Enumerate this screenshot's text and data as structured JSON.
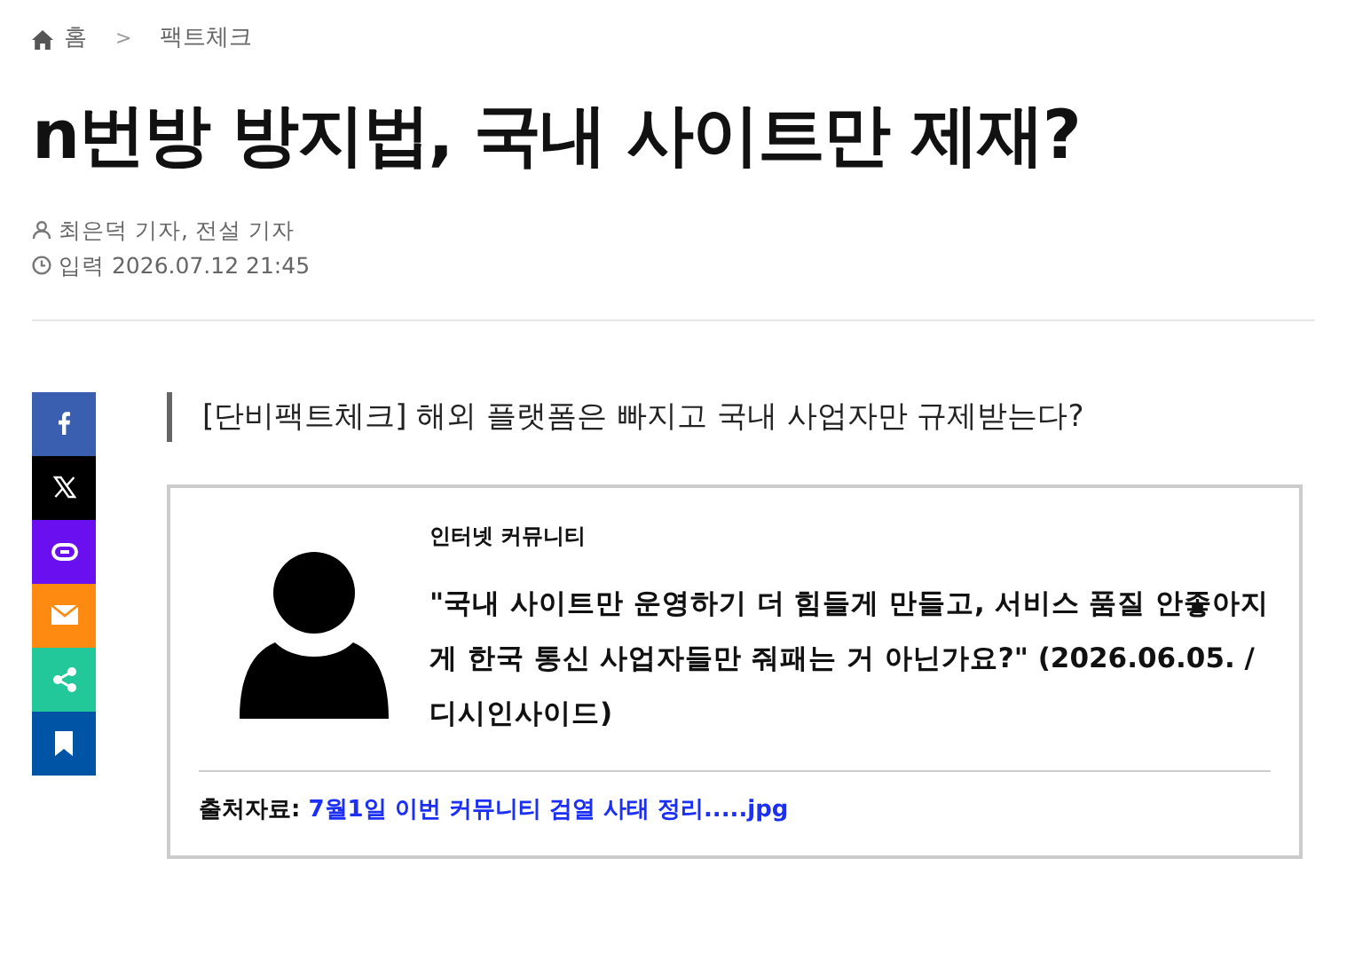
{
  "breadcrumb": [
    {
      "label": "홈",
      "kind": "home"
    },
    {
      "label": "팩트체크",
      "kind": "page"
    }
  ],
  "breadcrumb_separator": ">",
  "title": "n번방 방지법, 국내 사이트만 제재?",
  "byline": {
    "authors": "최은덕 기자, 전설 기자",
    "published": "입력 2026.07.12 21:45"
  },
  "share_buttons": [
    {
      "kind": "facebook",
      "color": "#3b5fb0"
    },
    {
      "kind": "x",
      "color": "#000000"
    },
    {
      "kind": "link",
      "color": "#6a10f0"
    },
    {
      "kind": "email",
      "color": "#ff8a12"
    },
    {
      "kind": "share",
      "color": "#22c79a"
    },
    {
      "kind": "bookmark",
      "color": "#0054a6"
    }
  ],
  "subtitle": "[단비팩트체크] 해외 플랫폼은 빠지고 국내 사업자만 규제받는다?",
  "quote_box": {
    "source_label": "인터넷 커뮤니티",
    "quote": "\"국내 사이트만 운영하기 더 힘들게 만들고, 서비스 품질 안좋아지게 한국 통신 사업자들만 줘패는 거 아닌가요?\" (2026.06.05. / 디시인사이드)",
    "reference_label": "출처자료:",
    "reference_link": "7월1일 이번 커뮤니티 검열 사태 정리.....jpg"
  }
}
